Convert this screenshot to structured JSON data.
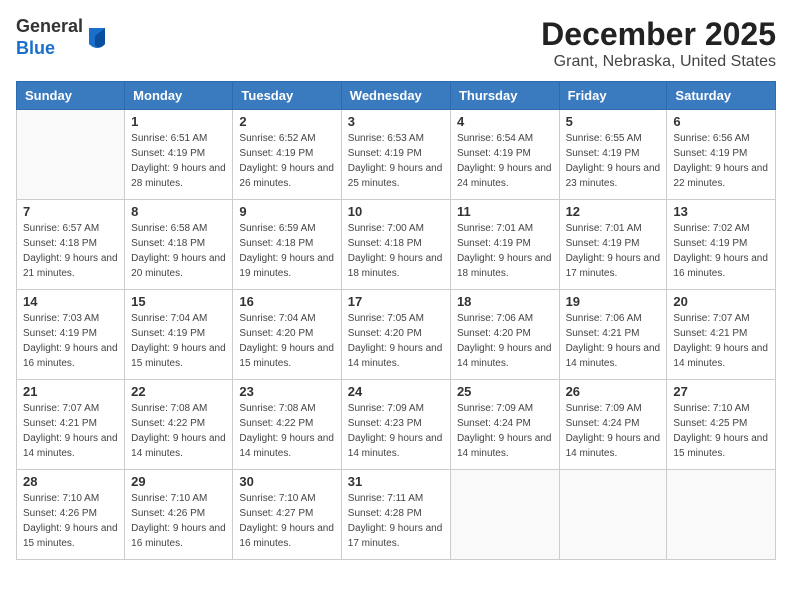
{
  "header": {
    "logo_line1": "General",
    "logo_line2": "Blue",
    "title": "December 2025",
    "subtitle": "Grant, Nebraska, United States"
  },
  "days_of_week": [
    "Sunday",
    "Monday",
    "Tuesday",
    "Wednesday",
    "Thursday",
    "Friday",
    "Saturday"
  ],
  "weeks": [
    [
      {
        "day": "",
        "sunrise": "",
        "sunset": "",
        "daylight": ""
      },
      {
        "day": "1",
        "sunrise": "6:51 AM",
        "sunset": "4:19 PM",
        "daylight": "9 hours and 28 minutes."
      },
      {
        "day": "2",
        "sunrise": "6:52 AM",
        "sunset": "4:19 PM",
        "daylight": "9 hours and 26 minutes."
      },
      {
        "day": "3",
        "sunrise": "6:53 AM",
        "sunset": "4:19 PM",
        "daylight": "9 hours and 25 minutes."
      },
      {
        "day": "4",
        "sunrise": "6:54 AM",
        "sunset": "4:19 PM",
        "daylight": "9 hours and 24 minutes."
      },
      {
        "day": "5",
        "sunrise": "6:55 AM",
        "sunset": "4:19 PM",
        "daylight": "9 hours and 23 minutes."
      },
      {
        "day": "6",
        "sunrise": "6:56 AM",
        "sunset": "4:19 PM",
        "daylight": "9 hours and 22 minutes."
      }
    ],
    [
      {
        "day": "7",
        "sunrise": "6:57 AM",
        "sunset": "4:18 PM",
        "daylight": "9 hours and 21 minutes."
      },
      {
        "day": "8",
        "sunrise": "6:58 AM",
        "sunset": "4:18 PM",
        "daylight": "9 hours and 20 minutes."
      },
      {
        "day": "9",
        "sunrise": "6:59 AM",
        "sunset": "4:18 PM",
        "daylight": "9 hours and 19 minutes."
      },
      {
        "day": "10",
        "sunrise": "7:00 AM",
        "sunset": "4:18 PM",
        "daylight": "9 hours and 18 minutes."
      },
      {
        "day": "11",
        "sunrise": "7:01 AM",
        "sunset": "4:19 PM",
        "daylight": "9 hours and 18 minutes."
      },
      {
        "day": "12",
        "sunrise": "7:01 AM",
        "sunset": "4:19 PM",
        "daylight": "9 hours and 17 minutes."
      },
      {
        "day": "13",
        "sunrise": "7:02 AM",
        "sunset": "4:19 PM",
        "daylight": "9 hours and 16 minutes."
      }
    ],
    [
      {
        "day": "14",
        "sunrise": "7:03 AM",
        "sunset": "4:19 PM",
        "daylight": "9 hours and 16 minutes."
      },
      {
        "day": "15",
        "sunrise": "7:04 AM",
        "sunset": "4:19 PM",
        "daylight": "9 hours and 15 minutes."
      },
      {
        "day": "16",
        "sunrise": "7:04 AM",
        "sunset": "4:20 PM",
        "daylight": "9 hours and 15 minutes."
      },
      {
        "day": "17",
        "sunrise": "7:05 AM",
        "sunset": "4:20 PM",
        "daylight": "9 hours and 14 minutes."
      },
      {
        "day": "18",
        "sunrise": "7:06 AM",
        "sunset": "4:20 PM",
        "daylight": "9 hours and 14 minutes."
      },
      {
        "day": "19",
        "sunrise": "7:06 AM",
        "sunset": "4:21 PM",
        "daylight": "9 hours and 14 minutes."
      },
      {
        "day": "20",
        "sunrise": "7:07 AM",
        "sunset": "4:21 PM",
        "daylight": "9 hours and 14 minutes."
      }
    ],
    [
      {
        "day": "21",
        "sunrise": "7:07 AM",
        "sunset": "4:21 PM",
        "daylight": "9 hours and 14 minutes."
      },
      {
        "day": "22",
        "sunrise": "7:08 AM",
        "sunset": "4:22 PM",
        "daylight": "9 hours and 14 minutes."
      },
      {
        "day": "23",
        "sunrise": "7:08 AM",
        "sunset": "4:22 PM",
        "daylight": "9 hours and 14 minutes."
      },
      {
        "day": "24",
        "sunrise": "7:09 AM",
        "sunset": "4:23 PM",
        "daylight": "9 hours and 14 minutes."
      },
      {
        "day": "25",
        "sunrise": "7:09 AM",
        "sunset": "4:24 PM",
        "daylight": "9 hours and 14 minutes."
      },
      {
        "day": "26",
        "sunrise": "7:09 AM",
        "sunset": "4:24 PM",
        "daylight": "9 hours and 14 minutes."
      },
      {
        "day": "27",
        "sunrise": "7:10 AM",
        "sunset": "4:25 PM",
        "daylight": "9 hours and 15 minutes."
      }
    ],
    [
      {
        "day": "28",
        "sunrise": "7:10 AM",
        "sunset": "4:26 PM",
        "daylight": "9 hours and 15 minutes."
      },
      {
        "day": "29",
        "sunrise": "7:10 AM",
        "sunset": "4:26 PM",
        "daylight": "9 hours and 16 minutes."
      },
      {
        "day": "30",
        "sunrise": "7:10 AM",
        "sunset": "4:27 PM",
        "daylight": "9 hours and 16 minutes."
      },
      {
        "day": "31",
        "sunrise": "7:11 AM",
        "sunset": "4:28 PM",
        "daylight": "9 hours and 17 minutes."
      },
      {
        "day": "",
        "sunrise": "",
        "sunset": "",
        "daylight": ""
      },
      {
        "day": "",
        "sunrise": "",
        "sunset": "",
        "daylight": ""
      },
      {
        "day": "",
        "sunrise": "",
        "sunset": "",
        "daylight": ""
      }
    ]
  ],
  "labels": {
    "sunrise_prefix": "Sunrise: ",
    "sunset_prefix": "Sunset: ",
    "daylight_prefix": "Daylight: "
  }
}
